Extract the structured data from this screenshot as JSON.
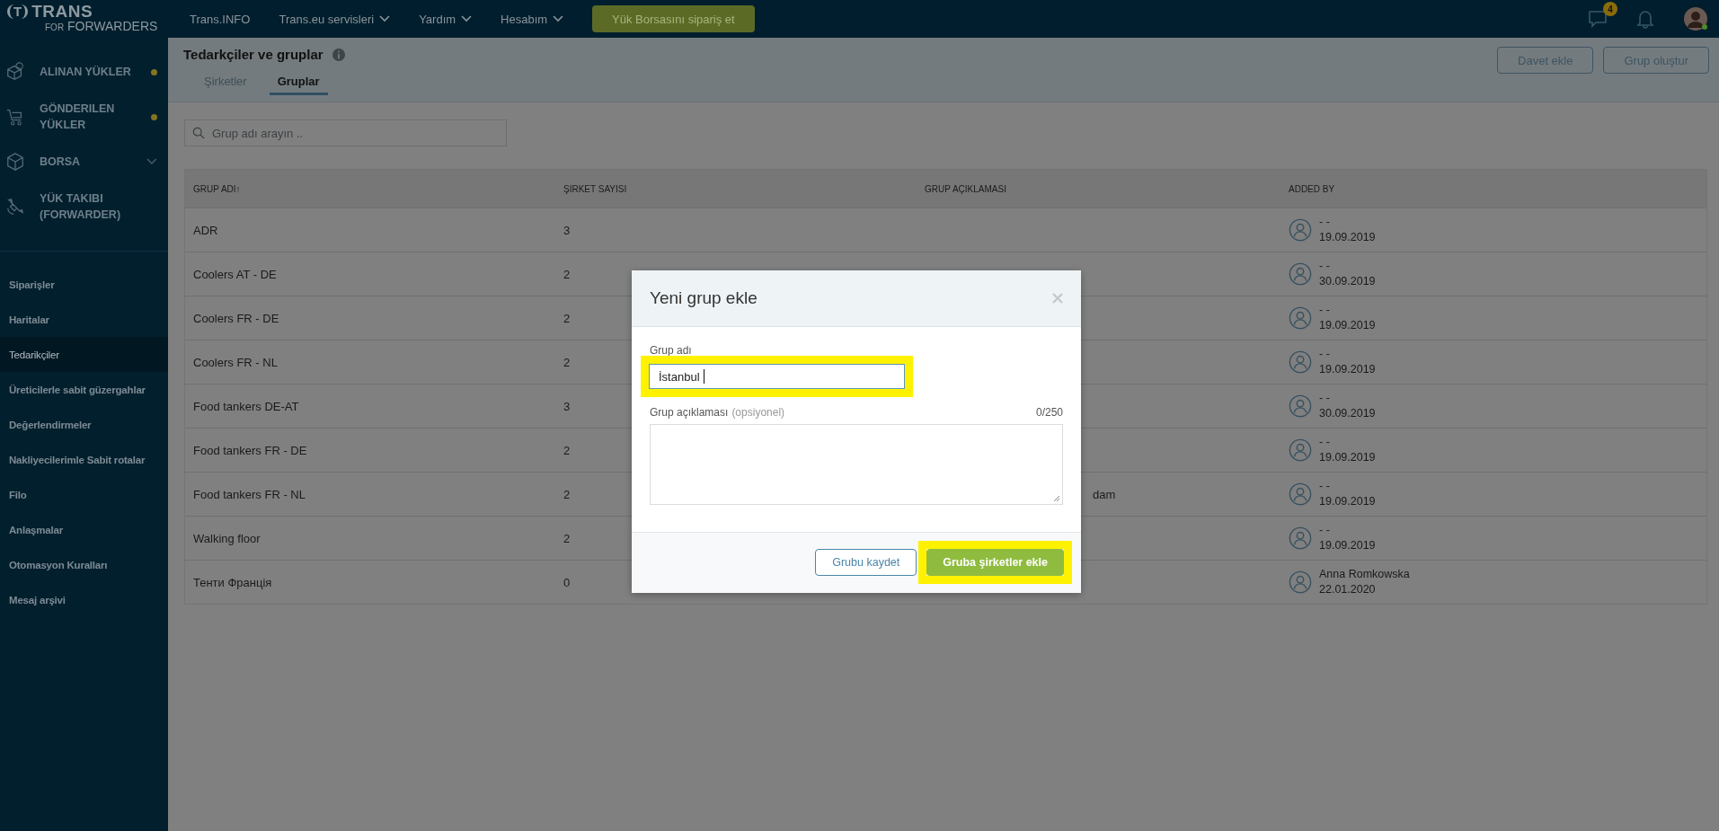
{
  "topbar": {
    "logo": {
      "mark": "T",
      "name": "TRANS",
      "tagline_prefix": "FOR",
      "tagline": "FORWARDERS"
    },
    "nav": [
      {
        "label": "Trans.INFO",
        "dropdown": false
      },
      {
        "label": "Trans.eu servisleri",
        "dropdown": true
      },
      {
        "label": "Yardım",
        "dropdown": true
      },
      {
        "label": "Hesabım",
        "dropdown": true
      }
    ],
    "cta": "Yük Borsasını sipariş et",
    "messages_badge": "4"
  },
  "sidebar": {
    "main_items": [
      {
        "label": "ALINAN YÜKLER",
        "kind": "box",
        "notification": true,
        "expandable": false
      },
      {
        "label": "GÖNDERILEN YÜKLER",
        "kind": "cart",
        "notification": true,
        "expandable": false
      },
      {
        "label": "BORSA",
        "kind": "cube",
        "notification": false,
        "expandable": true
      },
      {
        "label": "YÜK TAKIBI (FORWARDER)",
        "kind": "satellite",
        "notification": false,
        "expandable": false
      }
    ],
    "items": [
      {
        "label": "Siparişler",
        "selected": false
      },
      {
        "label": "Haritalar",
        "selected": false
      },
      {
        "label": "Tedarikçiler",
        "selected": true
      },
      {
        "label": "Üreticilerle sabit güzergahlar",
        "selected": false
      },
      {
        "label": "Değerlendirmeler",
        "selected": false
      },
      {
        "label": "Nakliyecilerimle Sabit rotalar",
        "selected": false
      },
      {
        "label": "Filo",
        "selected": false
      },
      {
        "label": "Anlaşmalar",
        "selected": false
      },
      {
        "label": "Otomasyon Kuralları",
        "selected": false
      },
      {
        "label": "Mesaj arşivi",
        "selected": false
      }
    ]
  },
  "page": {
    "title": "Tedarkçiler ve gruplar",
    "tabs": [
      {
        "label": "Şirketler",
        "selected": false
      },
      {
        "label": "Gruplar",
        "selected": true
      }
    ],
    "buttons": [
      "Davet ekle",
      "Grup oluştur"
    ],
    "search": {
      "placeholder": "Grup adı arayın .."
    },
    "table": {
      "columns": [
        {
          "label": "GRUP ADI",
          "sort_mark": "↑"
        },
        {
          "label": "ŞIRKET SAYISI"
        },
        {
          "label": "GRUP AÇIKLAMASI"
        },
        {
          "label": "ADDED BY"
        }
      ],
      "rows": [
        {
          "name": "ADR",
          "count": "3",
          "added_by": "- -",
          "date": "19.09.2019"
        },
        {
          "name": "Coolers AT - DE",
          "count": "2",
          "added_by": "- -",
          "date": "30.09.2019"
        },
        {
          "name": "Coolers FR - DE",
          "count": "2",
          "added_by": "- -",
          "date": "19.09.2019"
        },
        {
          "name": "Coolers FR - NL",
          "count": "2",
          "added_by": "- -",
          "date": "19.09.2019"
        },
        {
          "name": "Food tankers DE-AT",
          "count": "3",
          "added_by": "- -",
          "date": "30.09.2019"
        },
        {
          "name": "Food tankers FR - DE",
          "count": "2",
          "added_by": "- -",
          "date": "19.09.2019"
        },
        {
          "name": "Food tankers FR - NL",
          "count": "2",
          "description": "dam",
          "added_by": "- -",
          "date": "19.09.2019"
        },
        {
          "name": "Walking floor",
          "count": "2",
          "added_by": "- -",
          "date": "19.09.2019"
        },
        {
          "name": "Тенти Франція",
          "count": "0",
          "added_by": "Anna Romkowska",
          "date": "22.01.2020"
        }
      ]
    }
  },
  "modal": {
    "title": "Yeni grup ekle",
    "name_label": "Grup adı",
    "name_value": "İstanbul",
    "name_highlighted": true,
    "description_label": "Grup açıklaması",
    "description_hint": "(opsiyonel)",
    "counter": "0/250",
    "buttons": [
      {
        "label": "Grubu kaydet",
        "kind": "secondary",
        "highlighted": false
      },
      {
        "label": "Gruba şirketler ekle",
        "kind": "primary",
        "highlighted": true
      }
    ]
  }
}
